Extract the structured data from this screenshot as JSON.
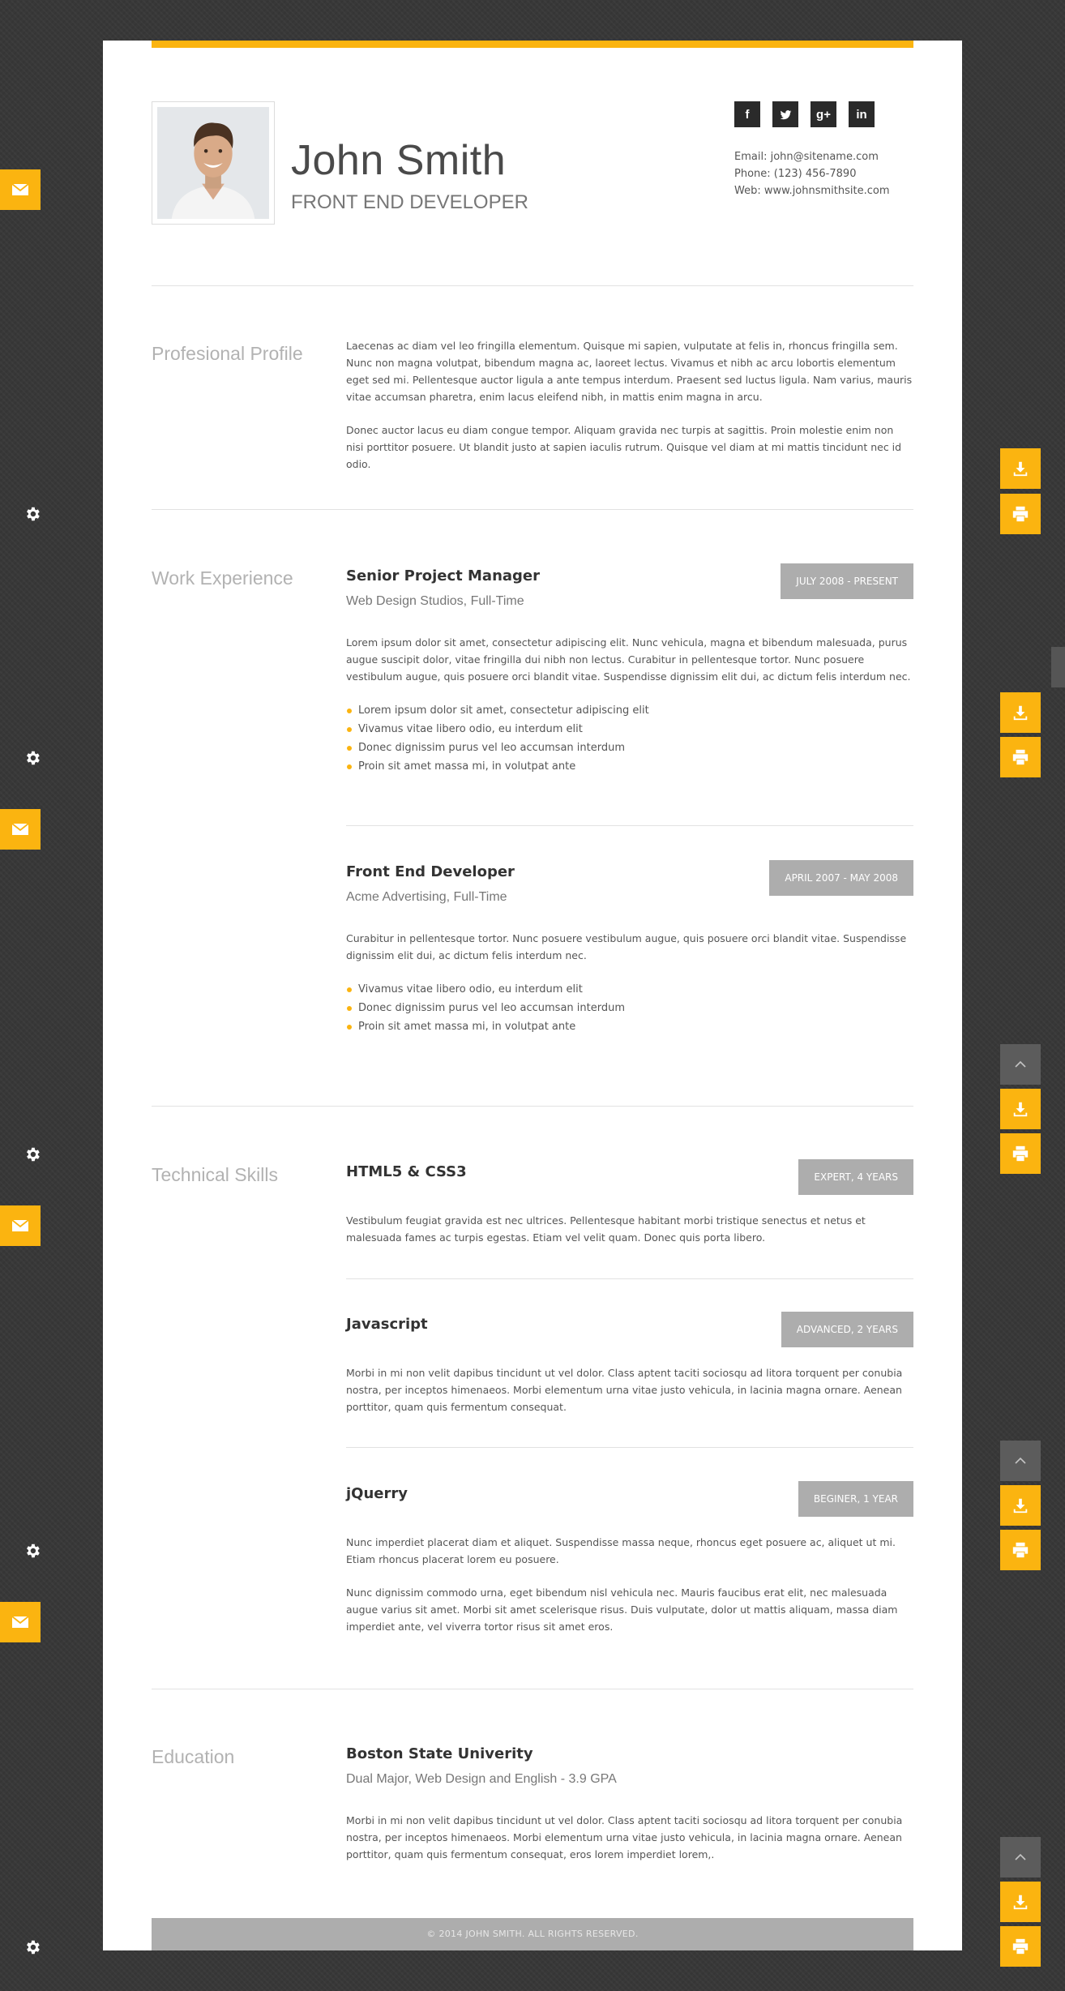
{
  "header": {
    "name": "John Smith",
    "role": "FRONT END DEVELOPER",
    "socials": [
      {
        "icon": "facebook-icon",
        "glyph": "f"
      },
      {
        "icon": "twitter-icon",
        "glyph": "t"
      },
      {
        "icon": "google-plus-icon",
        "glyph": "g+"
      },
      {
        "icon": "linkedin-icon",
        "glyph": "in"
      }
    ],
    "contact": {
      "email": "Email: john@sitename.com",
      "phone": "Phone: (123) 456-7890",
      "web": "Web: www.johnsmithsite.com"
    }
  },
  "profile": {
    "title": "Profesional Profile",
    "paragraphs": [
      "Laecenas ac diam vel leo fringilla elementum. Quisque mi sapien, vulputate at felis in, rhoncus fringilla sem. Nunc non magna volutpat, bibendum magna ac, laoreet lectus. Vivamus et nibh ac arcu lobortis elementum eget sed mi. Pellentesque auctor ligula a ante tempus interdum. Praesent sed luctus ligula. Nam varius, mauris vitae accumsan pharetra, enim lacus eleifend nibh, in mattis enim magna in arcu.",
      "Donec auctor lacus eu diam congue tempor. Aliquam gravida nec turpis at sagittis. Proin molestie enim non nisi porttitor posuere. Ut blandit justo at sapien iaculis rutrum. Quisque vel diam at mi mattis tincidunt nec id odio."
    ]
  },
  "work": {
    "title": "Work Experience",
    "jobs": [
      {
        "title": "Senior Project Manager",
        "company": "Web Design Studios, Full-Time",
        "dates": "JULY 2008 - PRESENT",
        "description": "Lorem ipsum dolor sit amet, consectetur adipiscing elit. Nunc vehicula, magna et bibendum malesuada, purus augue suscipit dolor, vitae fringilla dui nibh non lectus. Curabitur in pellentesque tortor. Nunc posuere vestibulum augue, quis posuere orci blandit vitae. Suspendisse dignissim elit dui, ac dictum felis interdum nec.",
        "bullets": [
          "Lorem ipsum dolor sit amet, consectetur adipiscing elit",
          "Vivamus vitae libero odio, eu interdum elit",
          "Donec dignissim purus vel leo accumsan interdum",
          "Proin sit amet massa mi, in volutpat ante"
        ]
      },
      {
        "title": "Front End Developer",
        "company": "Acme Advertising, Full-Time",
        "dates": "APRIL 2007 - MAY 2008",
        "description": "Curabitur in pellentesque tortor. Nunc posuere vestibulum augue, quis posuere orci blandit vitae. Suspendisse dignissim elit dui, ac dictum felis interdum nec.",
        "bullets": [
          "Vivamus vitae libero odio, eu interdum elit",
          "Donec dignissim purus vel leo accumsan interdum",
          "Proin sit amet massa mi, in volutpat ante"
        ]
      }
    ]
  },
  "skills": {
    "title": "Technical Skills",
    "items": [
      {
        "name": "HTML5 & CSS3",
        "level": "EXPERT, 4 YEARS",
        "paragraphs": [
          "Vestibulum feugiat gravida est nec ultrices. Pellentesque habitant morbi tristique senectus et netus et malesuada fames ac turpis egestas. Etiam vel velit quam. Donec quis porta libero."
        ]
      },
      {
        "name": "Javascript",
        "level": "ADVANCED, 2 YEARS",
        "paragraphs": [
          "Morbi in mi non velit dapibus tincidunt ut vel dolor. Class aptent taciti sociosqu ad litora torquent per conubia nostra, per inceptos himenaeos. Morbi elementum urna vitae justo vehicula, in lacinia magna ornare. Aenean porttitor, quam quis fermentum consequat."
        ]
      },
      {
        "name": "jQuerry",
        "level": "BEGINER, 1 YEAR",
        "paragraphs": [
          "Nunc imperdiet placerat diam et aliquet. Suspendisse massa neque, rhoncus eget posuere ac, aliquet ut mi. Etiam rhoncus placerat lorem eu posuere.",
          "Nunc dignissim commodo urna, eget bibendum nisl vehicula nec. Mauris faucibus erat elit, nec malesuada augue varius sit amet. Morbi sit amet scelerisque risus. Duis vulputate, dolor ut mattis aliquam, massa diam imperdiet ante, vel viverra tortor risus sit amet eros."
        ]
      }
    ]
  },
  "education": {
    "title": "Education",
    "school": "Boston State Univerity",
    "degree": "Dual Major, Web Design and English - 3.9 GPA",
    "description": "Morbi in mi non velit dapibus tincidunt ut vel dolor. Class aptent taciti sociosqu ad litora torquent per conubia nostra, per inceptos himenaeos. Morbi elementum urna vitae justo vehicula, in lacinia magna ornare. Aenean porttitor, quam quis fermentum consequat, eros lorem imperdiet lorem,."
  },
  "footer": {
    "text": "© 2014 JOHN SMITH. ALL RIGHTS RESERVED."
  },
  "colors": {
    "accent": "#fbb410",
    "badge": "#adadad",
    "background": "#383838",
    "dark_button": "#5c5c5c"
  },
  "controls": {
    "left_icons": [
      "mail-icon",
      "gear-icon"
    ],
    "right_icons": [
      "download-icon",
      "print-icon",
      "chevron-up-icon"
    ]
  }
}
